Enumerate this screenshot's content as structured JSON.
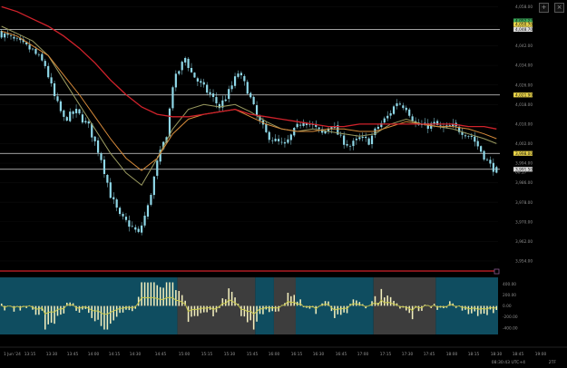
{
  "toolbar": {
    "plus_label": "+",
    "close_label": "×"
  },
  "statusbar": {
    "time_text": "08:30:43 UTC+4",
    "zoom_text": "2TF"
  },
  "colors": {
    "background": "#000000",
    "candle": "#8fd8e8",
    "ma_red": "#d0222b",
    "ma_orange": "#d68a3a",
    "ma_olive": "#9a9a60",
    "hline": "#d8d8d8",
    "volume_teal": "#0f4d60",
    "volume_grey": "#3d3d3d",
    "volume_bar": "#f2eebd",
    "volume_line": "#c8c84c",
    "volume_divider": "#d0222b",
    "price_label_yellow": "#e8d248",
    "price_label_white": "#dcdcdc",
    "price_label_green": "#3aa858"
  },
  "chart_data": {
    "type": "candlestick",
    "title": "",
    "x_ticks": [
      "1 Jun '24",
      "13:15",
      "13:30",
      "13:45",
      "14:00",
      "14:15",
      "14:30",
      "14:45",
      "15:00",
      "15:15",
      "15:30",
      "15:45",
      "16:00",
      "16:15",
      "16:30",
      "16:45",
      "17:00",
      "17:15",
      "17:30",
      "17:45",
      "18:00",
      "18:15",
      "18:30",
      "18:45",
      "19:00"
    ],
    "y_ticks": [
      4058,
      4050,
      4042,
      4034,
      4026,
      4018,
      4010,
      4002,
      3994,
      3986,
      3978,
      3970,
      3962,
      3954
    ],
    "y_tick_labels": [
      "4,058.00",
      "4,050.00",
      "4,042.00",
      "4,034.00",
      "4,026.00",
      "4,018.00",
      "4,010.00",
      "4,002.00",
      "3,994.00",
      "3,986.00",
      "3,978.00",
      "3,970.00",
      "3,962.00",
      "3,954.00"
    ],
    "y_range": [
      3951,
      4060
    ],
    "price_labels": [
      {
        "price": 4052.2,
        "text": "4,052.27",
        "style": "green"
      },
      {
        "price": 4050.7,
        "text": "4,050.70",
        "style": "yellow"
      },
      {
        "price": 4048.7,
        "text": "4,048.70",
        "style": "white"
      },
      {
        "price": 4021.9,
        "text": "4,021.90",
        "style": "yellow"
      },
      {
        "price": 3998.0,
        "text": "3,998.00",
        "style": "yellow"
      },
      {
        "price": 3991.5,
        "text": "3,991.50",
        "style": "white"
      },
      {
        "price": 3990.3,
        "text": "00:17",
        "style": "plain"
      }
    ],
    "horizontal_lines": [
      4048.7,
      4021.9,
      3998.0,
      3991.5
    ],
    "candle_count": 160,
    "close_path": [
      [
        0,
        4047
      ],
      [
        6,
        4043
      ],
      [
        10,
        4040
      ],
      [
        14,
        4034
      ],
      [
        17,
        4021
      ],
      [
        20,
        4012
      ],
      [
        24,
        4015
      ],
      [
        28,
        4009
      ],
      [
        32,
        3996
      ],
      [
        35,
        3981
      ],
      [
        38,
        3972
      ],
      [
        41,
        3969
      ],
      [
        44,
        3965
      ],
      [
        47,
        3976
      ],
      [
        50,
        3994
      ],
      [
        53,
        4006
      ],
      [
        55,
        4026
      ],
      [
        57,
        4032
      ],
      [
        59,
        4037
      ],
      [
        61,
        4031
      ],
      [
        64,
        4026
      ],
      [
        67,
        4022
      ],
      [
        70,
        4017
      ],
      [
        73,
        4023
      ],
      [
        76,
        4031
      ],
      [
        79,
        4024
      ],
      [
        82,
        4013
      ],
      [
        85,
        4006
      ],
      [
        88,
        4003
      ],
      [
        91,
        4001
      ],
      [
        94,
        4007
      ],
      [
        97,
        4012
      ],
      [
        100,
        4009
      ],
      [
        103,
        4006
      ],
      [
        106,
        4010
      ],
      [
        109,
        4004
      ],
      [
        112,
        4001
      ],
      [
        115,
        4004
      ],
      [
        118,
        4003
      ],
      [
        121,
        4009
      ],
      [
        124,
        4013
      ],
      [
        127,
        4019
      ],
      [
        130,
        4017
      ],
      [
        133,
        4010
      ],
      [
        136,
        4009
      ],
      [
        139,
        4010
      ],
      [
        142,
        4008
      ],
      [
        145,
        4009
      ],
      [
        148,
        4007
      ],
      [
        151,
        4005
      ],
      [
        154,
        3999
      ],
      [
        157,
        3993
      ],
      [
        159,
        3991
      ]
    ],
    "ma_red": [
      [
        0,
        4058
      ],
      [
        5,
        4056
      ],
      [
        10,
        4053
      ],
      [
        15,
        4050
      ],
      [
        20,
        4046
      ],
      [
        25,
        4041
      ],
      [
        30,
        4035
      ],
      [
        35,
        4028
      ],
      [
        40,
        4022
      ],
      [
        45,
        4017
      ],
      [
        50,
        4014
      ],
      [
        55,
        4013
      ],
      [
        60,
        4013
      ],
      [
        65,
        4014
      ],
      [
        70,
        4015
      ],
      [
        75,
        4016
      ],
      [
        80,
        4014
      ],
      [
        85,
        4013
      ],
      [
        90,
        4012
      ],
      [
        95,
        4011
      ],
      [
        100,
        4010
      ],
      [
        105,
        4009
      ],
      [
        110,
        4009
      ],
      [
        115,
        4010
      ],
      [
        120,
        4010
      ],
      [
        125,
        4010
      ],
      [
        130,
        4010
      ],
      [
        135,
        4010
      ],
      [
        140,
        4010
      ],
      [
        145,
        4010
      ],
      [
        150,
        4009
      ],
      [
        155,
        4009
      ],
      [
        159,
        4008
      ]
    ],
    "ma_orange": [
      [
        0,
        4048
      ],
      [
        5,
        4046
      ],
      [
        10,
        4042
      ],
      [
        15,
        4038
      ],
      [
        20,
        4030
      ],
      [
        25,
        4022
      ],
      [
        30,
        4013
      ],
      [
        35,
        4004
      ],
      [
        40,
        3996
      ],
      [
        45,
        3991
      ],
      [
        50,
        3996
      ],
      [
        55,
        4006
      ],
      [
        60,
        4012
      ],
      [
        65,
        4014
      ],
      [
        70,
        4015
      ],
      [
        75,
        4016
      ],
      [
        80,
        4013
      ],
      [
        85,
        4010
      ],
      [
        90,
        4008
      ],
      [
        95,
        4007
      ],
      [
        100,
        4007
      ],
      [
        105,
        4008
      ],
      [
        110,
        4008
      ],
      [
        115,
        4007
      ],
      [
        120,
        4007
      ],
      [
        125,
        4009
      ],
      [
        130,
        4011
      ],
      [
        135,
        4010
      ],
      [
        140,
        4009
      ],
      [
        145,
        4009
      ],
      [
        150,
        4008
      ],
      [
        155,
        4006
      ],
      [
        159,
        4004
      ]
    ],
    "ma_olive": [
      [
        0,
        4050
      ],
      [
        5,
        4047
      ],
      [
        10,
        4044
      ],
      [
        15,
        4038
      ],
      [
        20,
        4028
      ],
      [
        25,
        4018
      ],
      [
        30,
        4008
      ],
      [
        35,
        3998
      ],
      [
        40,
        3990
      ],
      [
        45,
        3985
      ],
      [
        50,
        3996
      ],
      [
        55,
        4008
      ],
      [
        60,
        4016
      ],
      [
        65,
        4018
      ],
      [
        70,
        4017
      ],
      [
        75,
        4018
      ],
      [
        80,
        4015
      ],
      [
        85,
        4011
      ],
      [
        90,
        4008
      ],
      [
        95,
        4007
      ],
      [
        100,
        4008
      ],
      [
        105,
        4007
      ],
      [
        110,
        4006
      ],
      [
        115,
        4005
      ],
      [
        120,
        4006
      ],
      [
        125,
        4010
      ],
      [
        130,
        4012
      ],
      [
        135,
        4010
      ],
      [
        140,
        4009
      ],
      [
        145,
        4008
      ],
      [
        150,
        4006
      ],
      [
        155,
        4004
      ],
      [
        159,
        4002
      ]
    ],
    "volume": {
      "y_ticks": [
        400,
        200,
        0,
        -200,
        -400
      ],
      "y_tick_labels": [
        "400.00",
        "200.00",
        "0.00",
        "-200.00",
        "-400.00"
      ],
      "y_range": [
        -520,
        520
      ],
      "background_segments": [
        {
          "from": 0,
          "to": 57,
          "tone": "teal"
        },
        {
          "from": 57,
          "to": 82,
          "tone": "grey"
        },
        {
          "from": 82,
          "to": 88,
          "tone": "teal"
        },
        {
          "from": 88,
          "to": 95,
          "tone": "grey"
        },
        {
          "from": 95,
          "to": 120,
          "tone": "teal"
        },
        {
          "from": 120,
          "to": 140,
          "tone": "grey"
        },
        {
          "from": 140,
          "to": 160,
          "tone": "teal"
        }
      ]
    }
  }
}
